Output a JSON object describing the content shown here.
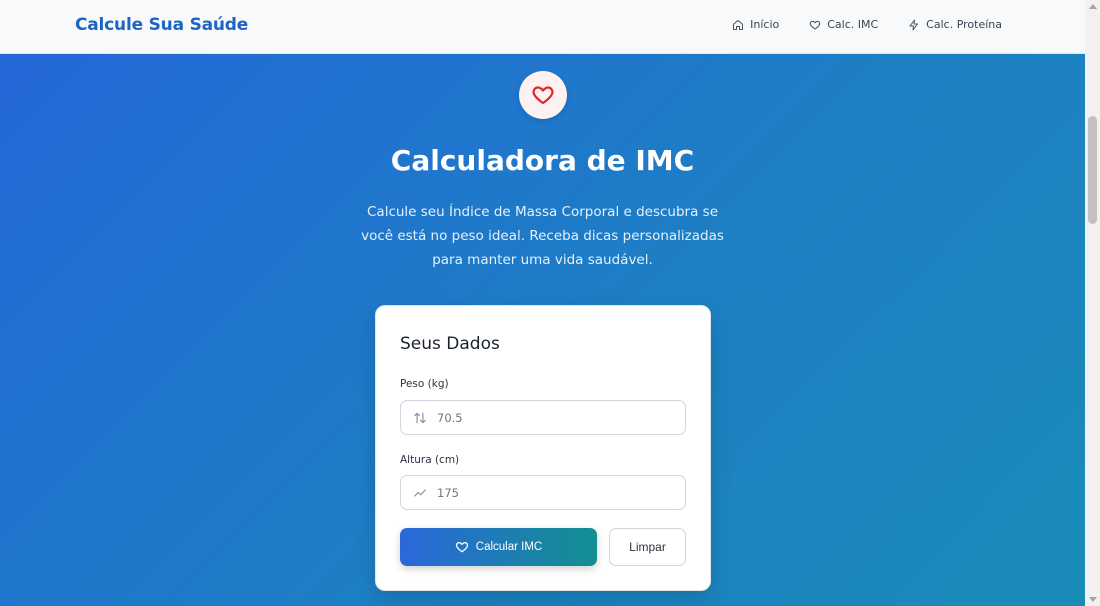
{
  "nav": {
    "brand": "Calcule Sua Saúde",
    "links": [
      {
        "label": "Início",
        "icon": "home-icon"
      },
      {
        "label": "Calc. IMC",
        "icon": "heart-icon"
      },
      {
        "label": "Calc. Proteína",
        "icon": "lightning-icon"
      }
    ]
  },
  "hero": {
    "icon": "heart-icon",
    "title": "Calculadora de IMC",
    "description": "Calcule seu Índice de Massa Corporal e descubra se você está no peso ideal. Receba dicas personalizadas para manter uma vida saudável."
  },
  "form": {
    "title": "Seus Dados",
    "weight": {
      "label": "Peso (kg)",
      "placeholder": "70.5",
      "icon": "arrows-updown-icon"
    },
    "height": {
      "label": "Altura (cm)",
      "placeholder": "175",
      "icon": "trend-icon"
    },
    "calculate_label": "Calcular IMC",
    "clear_label": "Limpar"
  },
  "colors": {
    "brand": "#1d64c4",
    "hero_start": "#2468d8",
    "hero_end": "#1a8cb8",
    "heart": "#e0252b",
    "button_start": "#2a68dc",
    "button_end": "#138f90"
  }
}
